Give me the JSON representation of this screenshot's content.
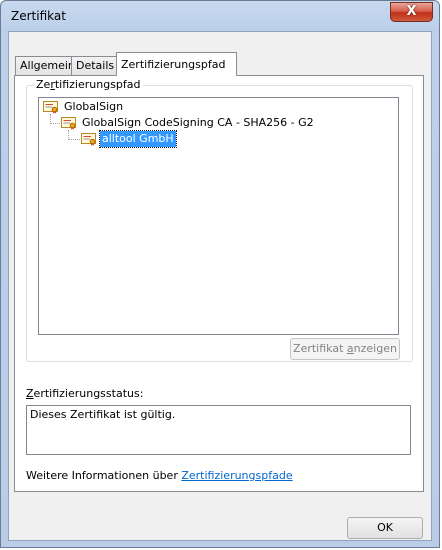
{
  "window": {
    "title": "Zertifikat",
    "close_glyph": "X"
  },
  "tabs": [
    {
      "label": "Allgemein",
      "active": false
    },
    {
      "label": "Details",
      "active": false
    },
    {
      "label": "Zertifizierungspfad",
      "active": true
    }
  ],
  "path_group": {
    "legend_pre": "Ze",
    "legend_mnemonic": "r",
    "legend_post": "tifizierungspfad",
    "tree": [
      {
        "label": "GlobalSign",
        "level": 0,
        "icon": "certificate-icon"
      },
      {
        "label": "GlobalSign CodeSigning CA - SHA256 - G2",
        "level": 1,
        "icon": "certificate-icon"
      },
      {
        "label": "alltool GmbH",
        "level": 2,
        "icon": "certificate-icon",
        "selected": true
      }
    ],
    "view_button": {
      "pre": "Zertifikat ",
      "mnemonic": "a",
      "post": "nzeigen",
      "enabled": false
    }
  },
  "status": {
    "label_mnemonic": "Z",
    "label_post": "ertifizierungsstatus:",
    "text": "Dieses Zertifikat ist gültig."
  },
  "more_info": {
    "prefix": "Weitere Informationen über ",
    "link": "Zertifizierungspfade"
  },
  "ok_button": {
    "label": "OK"
  },
  "colors": {
    "selection": "#3399ff",
    "link": "#0066cc",
    "close_button": "#c2301a"
  }
}
